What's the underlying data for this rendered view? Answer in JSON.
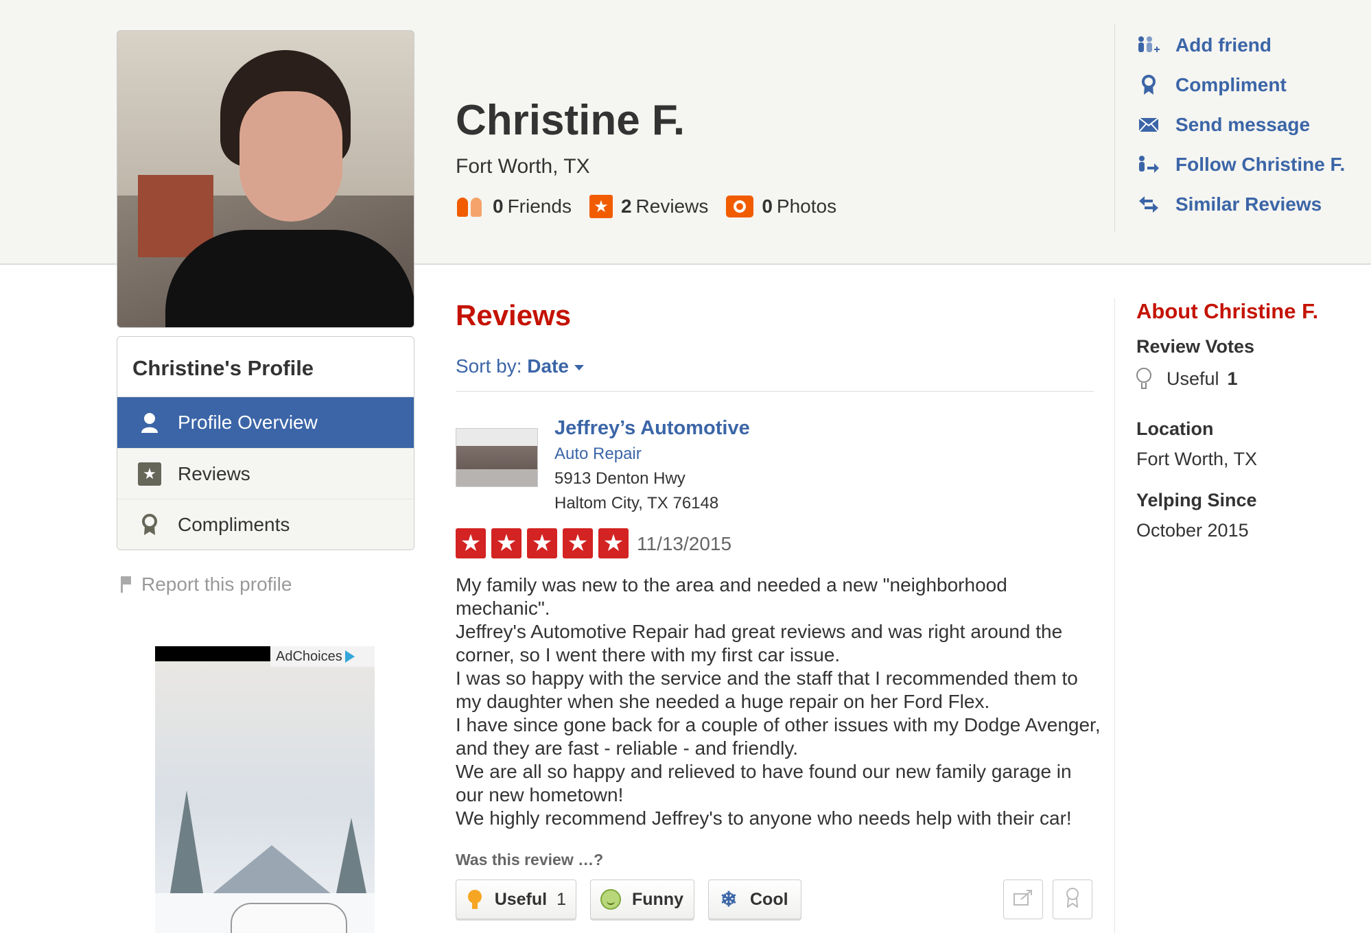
{
  "colors": {
    "brand_red": "#c41200",
    "link_blue": "#3b65a7",
    "star_red": "#d32323",
    "stat_orange": "#f15c00",
    "header_bg": "#f5f5f1"
  },
  "user": {
    "name": "Christine F.",
    "location": "Fort Worth, TX",
    "stats": [
      {
        "icon": "friends-icon",
        "count": "0",
        "label": "Friends"
      },
      {
        "icon": "review-star-icon",
        "count": "2",
        "label": "Reviews"
      },
      {
        "icon": "camera-icon",
        "count": "0",
        "label": "Photos"
      }
    ]
  },
  "actions": [
    {
      "icon": "add-friend-icon",
      "label": "Add friend"
    },
    {
      "icon": "compliment-icon",
      "label": "Compliment"
    },
    {
      "icon": "envelope-icon",
      "label": "Send message"
    },
    {
      "icon": "follow-icon",
      "label": "Follow Christine F."
    },
    {
      "icon": "similar-arrows-icon",
      "label": "Similar Reviews"
    }
  ],
  "sidebar": {
    "title": "Christine's Profile",
    "items": [
      {
        "icon": "user-icon",
        "label": "Profile Overview",
        "active": true
      },
      {
        "icon": "star-icon",
        "label": "Reviews",
        "active": false
      },
      {
        "icon": "ribbon-icon",
        "label": "Compliments",
        "active": false
      }
    ],
    "report_label": "Report this profile",
    "ad_label": "AdChoices"
  },
  "main": {
    "section_title": "Reviews",
    "sort_prefix": "Sort by:",
    "sort_value": "Date",
    "review": {
      "business_name": "Jeffrey’s Automotive",
      "category": "Auto Repair",
      "address_line1": "5913 Denton Hwy",
      "address_line2": "Haltom City, TX 76148",
      "rating": 5,
      "date": "11/13/2015",
      "paragraphs": [
        "My family was new to the area and needed a new \"neighborhood mechanic\".",
        "Jeffrey's Automotive Repair had great reviews and was right around the corner, so I went there with my first car issue.",
        "I was so happy with the service and the staff that I recommended them to my daughter when she needed a huge repair on her Ford Flex.",
        "I have since gone back for a couple of other issues with my Dodge Avenger, and they are fast - reliable - and friendly.",
        "We are all so happy and relieved to have found our new family garage in our new hometown!",
        "We highly recommend Jeffrey's to anyone who needs help with their car!"
      ],
      "was_this_review": "Was this review …?",
      "votes": [
        {
          "icon": "bulb-icon",
          "label": "Useful",
          "count": "1"
        },
        {
          "icon": "smiley-icon",
          "label": "Funny",
          "count": ""
        },
        {
          "icon": "snowflake-icon",
          "label": "Cool",
          "count": ""
        }
      ]
    }
  },
  "about": {
    "title": "About Christine F.",
    "review_votes_heading": "Review Votes",
    "useful_label": "Useful",
    "useful_count": "1",
    "location_heading": "Location",
    "location_value": "Fort Worth, TX",
    "since_heading": "Yelping Since",
    "since_value": "October 2015"
  }
}
